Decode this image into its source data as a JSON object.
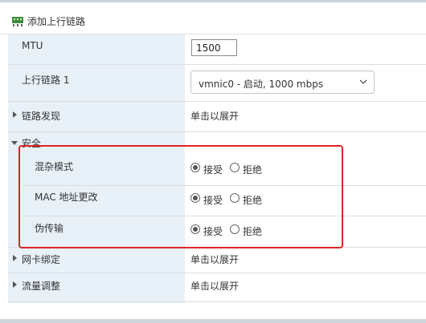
{
  "header": {
    "title": "添加上行链路",
    "icon": "network-adapter-icon"
  },
  "mtu": {
    "label": "MTU",
    "value": "1500"
  },
  "uplink": {
    "label": "上行链路 1",
    "selected": "vmnic0 - 启动, 1000 mbps"
  },
  "link_discovery": {
    "label": "链路发现",
    "value": "单击以展开"
  },
  "security": {
    "label": "安全",
    "accept_label": "接受",
    "reject_label": "拒绝",
    "rows": [
      {
        "label": "混杂模式",
        "selected": "接受"
      },
      {
        "label": "MAC 地址更改",
        "selected": "接受"
      },
      {
        "label": "伪传输",
        "selected": "接受"
      }
    ]
  },
  "nic_teaming": {
    "label": "网卡绑定",
    "value": "单击以展开"
  },
  "traffic_shaping": {
    "label": "流量调整",
    "value": "单击以展开"
  },
  "colors": {
    "highlight": "#e02424",
    "label_bg": "#e8f1f8"
  }
}
